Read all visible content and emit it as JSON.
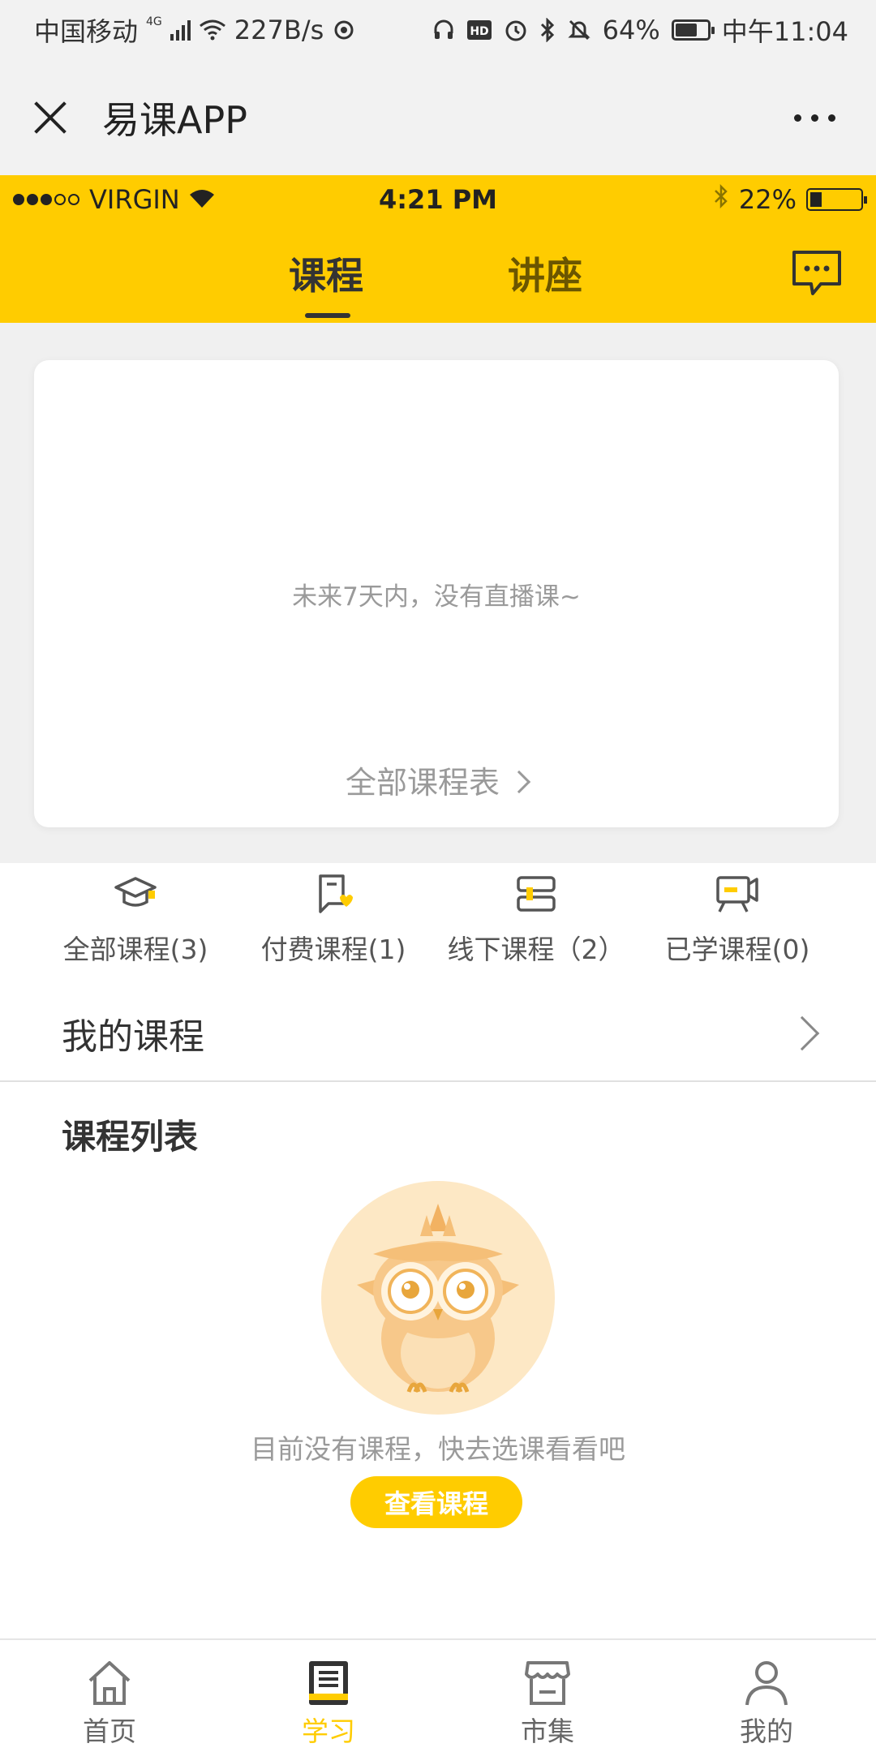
{
  "android_status": {
    "carrier": "中国移动",
    "network": "4G",
    "speed": "227B/s",
    "battery": "64%",
    "battery_level": 0.64,
    "time": "中午11:04"
  },
  "wx_header": {
    "title": "易课APP",
    "close_icon": "close-icon",
    "more_icon": "more-icon"
  },
  "ios_status": {
    "carrier": "VIRGIN",
    "time": "4:21 PM",
    "battery": "22%",
    "battery_level": 0.22
  },
  "tabs": [
    {
      "label": "课程",
      "active": true
    },
    {
      "label": "讲座",
      "active": false
    }
  ],
  "schedule_card": {
    "empty_text": "未来7天内，没有直播课~",
    "link_label": "全部课程表"
  },
  "categories": [
    {
      "label": "全部课程(3)",
      "icon": "graduation-cap-icon"
    },
    {
      "label": "付费课程(1)",
      "icon": "paid-course-icon"
    },
    {
      "label": "线下课程（2）",
      "icon": "offline-course-icon"
    },
    {
      "label": "已学课程(0)",
      "icon": "video-course-icon"
    }
  ],
  "my_courses": {
    "label": "我的课程"
  },
  "course_list": {
    "title": "课程列表",
    "empty_text": "目前没有课程，快去选课看看吧",
    "button_label": "查看课程"
  },
  "bottom_nav": [
    {
      "label": "首页",
      "icon": "home-icon",
      "active": false
    },
    {
      "label": "学习",
      "icon": "book-icon",
      "active": true
    },
    {
      "label": "市集",
      "icon": "market-icon",
      "active": false
    },
    {
      "label": "我的",
      "icon": "user-icon",
      "active": false
    }
  ],
  "colors": {
    "accent": "#ffcc00",
    "text": "#333333",
    "muted": "#9a9a9a"
  }
}
